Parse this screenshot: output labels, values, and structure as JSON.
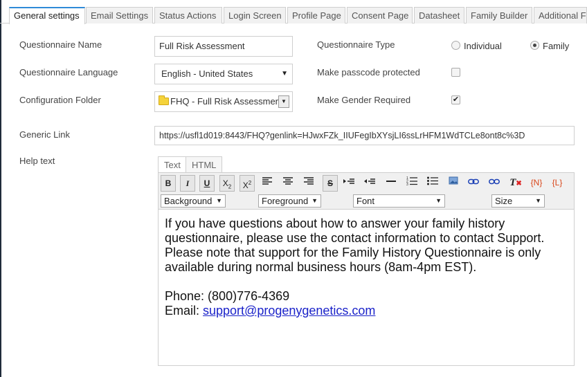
{
  "tabs": [
    {
      "label": "General settings"
    },
    {
      "label": "Email Settings"
    },
    {
      "label": "Status Actions"
    },
    {
      "label": "Login Screen"
    },
    {
      "label": "Profile Page"
    },
    {
      "label": "Consent Page"
    },
    {
      "label": "Datasheet"
    },
    {
      "label": "Family Builder"
    },
    {
      "label": "Additional F"
    }
  ],
  "form": {
    "name_label": "Questionnaire Name",
    "name_value": "Full Risk Assessment",
    "language_label": "Questionnaire Language",
    "language_value": "English - United States",
    "folder_label": "Configuration Folder",
    "folder_value": "FHQ - Full Risk Assessment",
    "type_label": "Questionnaire Type",
    "type_option_individual": "Individual",
    "type_option_family": "Family",
    "type_selected": "Family",
    "passcode_label": "Make passcode protected",
    "passcode_checked": false,
    "gender_label": "Make Gender Required",
    "gender_checked": true,
    "link_label": "Generic Link",
    "link_value": "https://usfl1d019:8443/FHQ?genlink=HJwxFZk_IIUFegIbXYsjLI6ssLrHFM1WdTCLe8ont8c%3D",
    "help_label": "Help text"
  },
  "editor": {
    "tab_text": "Text",
    "tab_html": "HTML",
    "toolbar": {
      "bold": "B",
      "italic": "I",
      "underline": "U",
      "subscript": "X",
      "superscript": "X",
      "insert_name": "{N}",
      "insert_link": "{L}"
    },
    "selects": {
      "background": "Background",
      "foreground": "Foreground",
      "font": "Font",
      "size": "Size"
    },
    "content": {
      "paragraph1": "If you have questions about how to answer your family history questionnaire, please use the contact information to contact Support. Please note that support for the Family History Questionnaire is only available during normal business hours (8am-4pm EST).",
      "phone": "Phone: (800)776-4369",
      "email_prefix": "Email: ",
      "email_link": "support@progenygenetics.com"
    }
  },
  "colors": {
    "accent": "#2e8ad8",
    "link": "#1a22c9",
    "insert_field": "#d9461a"
  }
}
